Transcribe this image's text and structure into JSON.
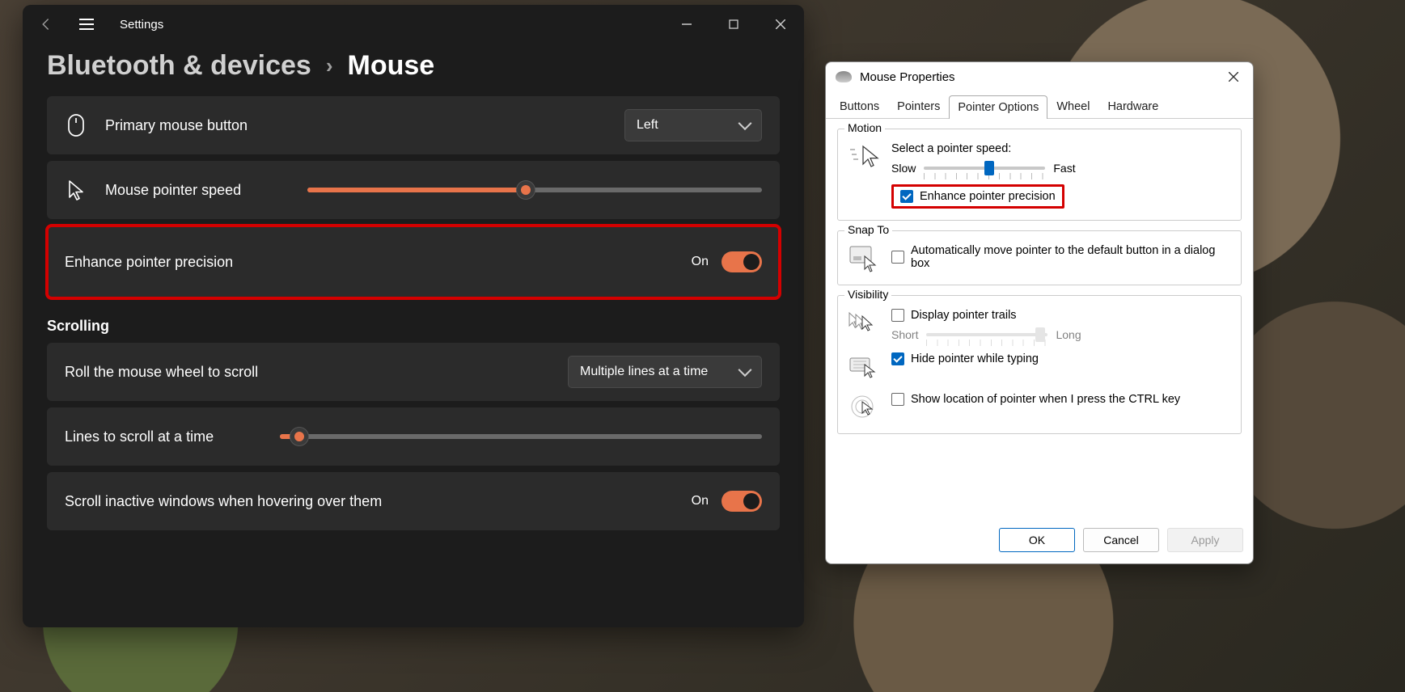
{
  "settings": {
    "app_title": "Settings",
    "breadcrumb_parent": "Bluetooth & devices",
    "breadcrumb_current": "Mouse",
    "primary_button": {
      "label": "Primary mouse button",
      "value": "Left"
    },
    "pointer_speed": {
      "label": "Mouse pointer speed",
      "percent": 48
    },
    "enhance_precision": {
      "label": "Enhance pointer precision",
      "state": "On",
      "on": true
    },
    "scrolling_heading": "Scrolling",
    "roll_wheel": {
      "label": "Roll the mouse wheel to scroll",
      "value": "Multiple lines at a time"
    },
    "lines_at_a_time": {
      "label": "Lines to scroll at a time",
      "percent": 4
    },
    "scroll_inactive": {
      "label": "Scroll inactive windows when hovering over them",
      "state": "On",
      "on": true
    }
  },
  "props": {
    "title": "Mouse Properties",
    "tabs": [
      "Buttons",
      "Pointers",
      "Pointer Options",
      "Wheel",
      "Hardware"
    ],
    "active_tab": 2,
    "motion": {
      "legend": "Motion",
      "select_label": "Select a pointer speed:",
      "slow": "Slow",
      "fast": "Fast",
      "slider_percent": 50,
      "enhance_label": "Enhance pointer precision",
      "enhance_checked": true
    },
    "snap": {
      "legend": "Snap To",
      "label": "Automatically move pointer to the default button in a dialog box",
      "checked": false
    },
    "visibility": {
      "legend": "Visibility",
      "trails_label": "Display pointer trails",
      "trails_checked": false,
      "short": "Short",
      "long": "Long",
      "trails_percent": 90,
      "hide_label": "Hide pointer while typing",
      "hide_checked": true,
      "ctrl_label": "Show location of pointer when I press the CTRL key",
      "ctrl_checked": false
    },
    "buttons": {
      "ok": "OK",
      "cancel": "Cancel",
      "apply": "Apply"
    }
  }
}
